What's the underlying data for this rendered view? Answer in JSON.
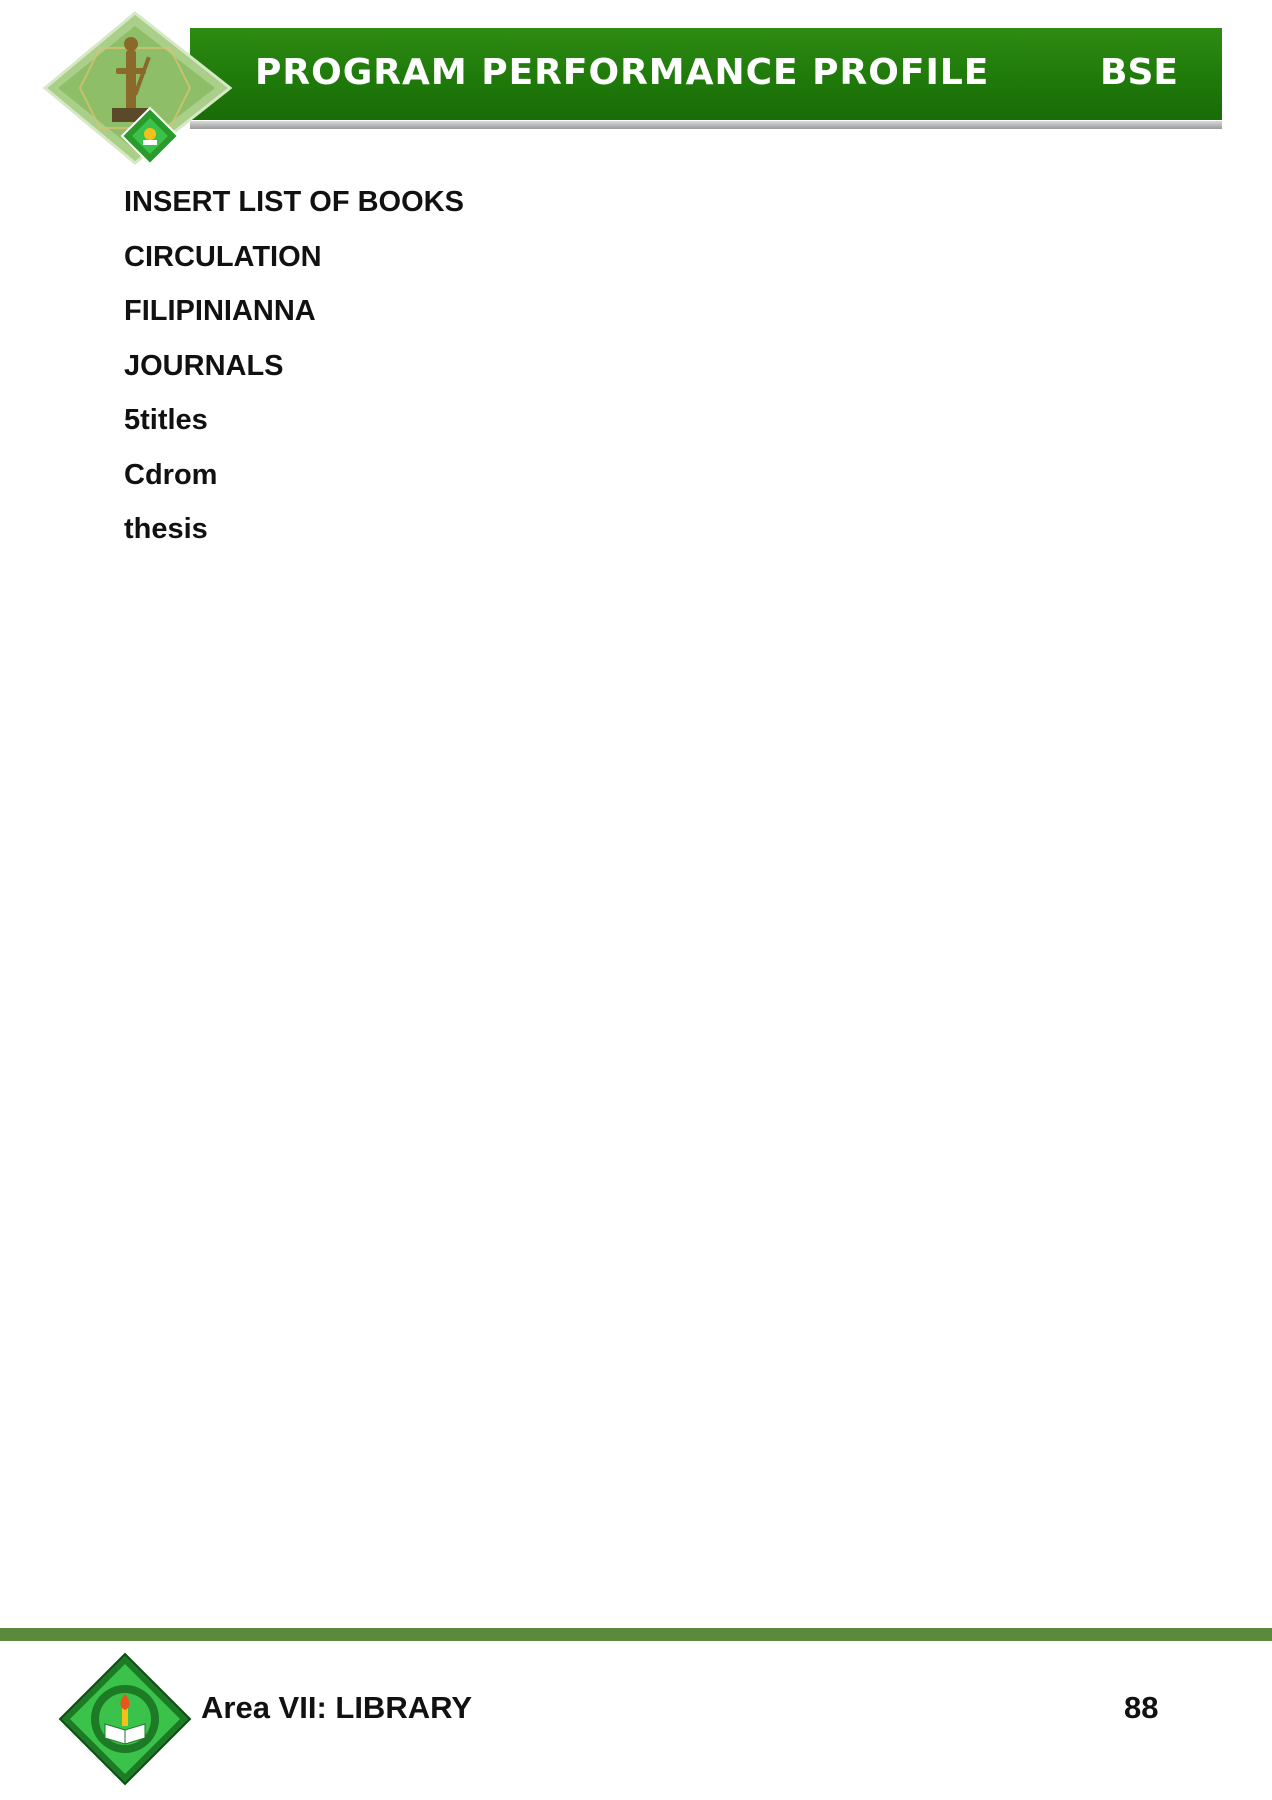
{
  "header": {
    "title": "PROGRAM PERFORMANCE PROFILE",
    "program_code": "BSE",
    "emblem_icon": "university-emblem-icon"
  },
  "content": {
    "items": [
      "INSERT LIST OF BOOKS",
      "CIRCULATION",
      "FILIPINIANNA",
      "JOURNALS",
      "5titles",
      "Cdrom",
      "thesis"
    ]
  },
  "footer": {
    "area_label": "Area VII: LIBRARY",
    "page_number": "88",
    "seal_icon": "university-seal-icon"
  },
  "colors": {
    "header_green": "#1f7a0a",
    "footer_rule": "#5a8a3a",
    "seal_green": "#3ac24a"
  }
}
